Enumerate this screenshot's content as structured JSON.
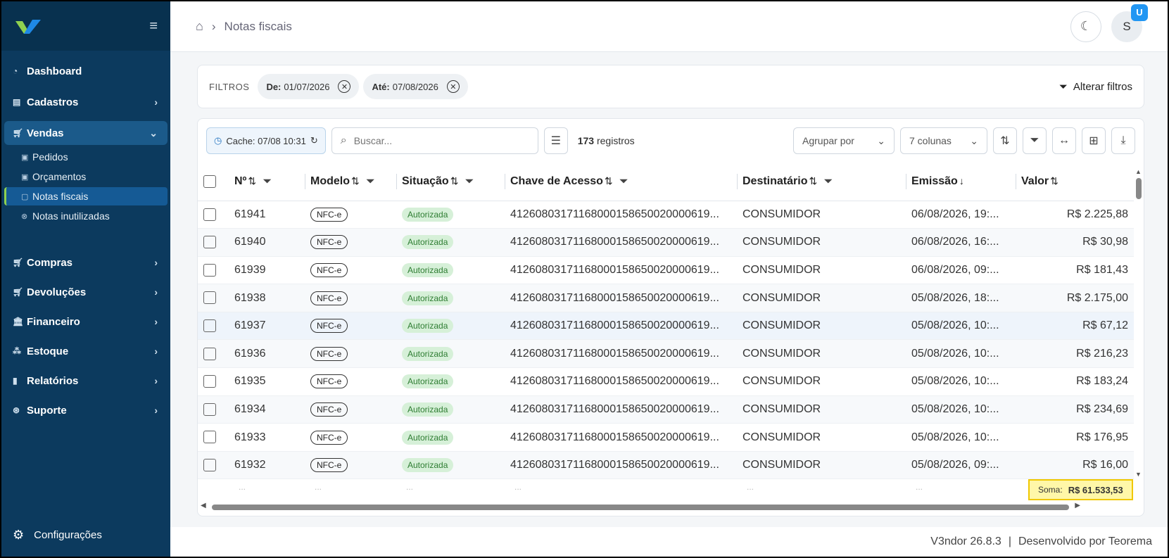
{
  "sidebar": {
    "items": [
      {
        "label": "Dashboard",
        "icon": "dashboard-icon"
      },
      {
        "label": "Cadastros",
        "icon": "list-icon"
      },
      {
        "label": "Vendas",
        "icon": "cart-icon"
      },
      {
        "label": "Compras",
        "icon": "cart-icon"
      },
      {
        "label": "Devoluções",
        "icon": "cart-icon"
      },
      {
        "label": "Financeiro",
        "icon": "bank-icon"
      },
      {
        "label": "Estoque",
        "icon": "boxes-icon"
      },
      {
        "label": "Relatórios",
        "icon": "bar-chart-icon"
      },
      {
        "label": "Suporte",
        "icon": "support-icon"
      }
    ],
    "sub_items": [
      {
        "label": "Pedidos"
      },
      {
        "label": "Orçamentos"
      },
      {
        "label": "Notas fiscais"
      },
      {
        "label": "Notas inutilizadas"
      }
    ],
    "settings_label": "Configurações"
  },
  "topbar": {
    "breadcrumb": "Notas fiscais",
    "avatar_letter": "S",
    "badge_letter": "U"
  },
  "filters": {
    "label": "FILTROS",
    "chips": [
      {
        "key": "De:",
        "value": "01/07/2026"
      },
      {
        "key": "Até:",
        "value": "07/08/2026"
      }
    ],
    "change_label": "Alterar filtros"
  },
  "toolbar": {
    "cache": "Cache: 07/08 10:31",
    "search_placeholder": "Buscar...",
    "count": "173",
    "count_suffix": "registros",
    "group_by": "Agrupar por",
    "columns": "7 colunas"
  },
  "table": {
    "headers": [
      "Nº",
      "Modelo",
      "Situação",
      "Chave de Acesso",
      "Destinatário",
      "Emissão",
      "Valor"
    ],
    "rows": [
      {
        "num": "61941",
        "modelo": "NFC-e",
        "situacao": "Autorizada",
        "chave": "41260803171168000158650020000619...",
        "dest": "CONSUMIDOR",
        "emissao": "06/08/2026, 19:...",
        "valor": "R$ 2.225,88"
      },
      {
        "num": "61940",
        "modelo": "NFC-e",
        "situacao": "Autorizada",
        "chave": "41260803171168000158650020000619...",
        "dest": "CONSUMIDOR",
        "emissao": "06/08/2026, 16:...",
        "valor": "R$ 30,98"
      },
      {
        "num": "61939",
        "modelo": "NFC-e",
        "situacao": "Autorizada",
        "chave": "41260803171168000158650020000619...",
        "dest": "CONSUMIDOR",
        "emissao": "06/08/2026, 09:...",
        "valor": "R$ 181,43"
      },
      {
        "num": "61938",
        "modelo": "NFC-e",
        "situacao": "Autorizada",
        "chave": "41260803171168000158650020000619...",
        "dest": "CONSUMIDOR",
        "emissao": "05/08/2026, 18:...",
        "valor": "R$ 2.175,00"
      },
      {
        "num": "61937",
        "modelo": "NFC-e",
        "situacao": "Autorizada",
        "chave": "41260803171168000158650020000619...",
        "dest": "CONSUMIDOR",
        "emissao": "05/08/2026, 10:...",
        "valor": "R$ 67,12"
      },
      {
        "num": "61936",
        "modelo": "NFC-e",
        "situacao": "Autorizada",
        "chave": "41260803171168000158650020000619...",
        "dest": "CONSUMIDOR",
        "emissao": "05/08/2026, 10:...",
        "valor": "R$ 216,23"
      },
      {
        "num": "61935",
        "modelo": "NFC-e",
        "situacao": "Autorizada",
        "chave": "41260803171168000158650020000619...",
        "dest": "CONSUMIDOR",
        "emissao": "05/08/2026, 10:...",
        "valor": "R$ 183,24"
      },
      {
        "num": "61934",
        "modelo": "NFC-e",
        "situacao": "Autorizada",
        "chave": "41260803171168000158650020000619...",
        "dest": "CONSUMIDOR",
        "emissao": "05/08/2026, 10:...",
        "valor": "R$ 234,69"
      },
      {
        "num": "61933",
        "modelo": "NFC-e",
        "situacao": "Autorizada",
        "chave": "41260803171168000158650020000619...",
        "dest": "CONSUMIDOR",
        "emissao": "05/08/2026, 10:...",
        "valor": "R$ 176,95"
      },
      {
        "num": "61932",
        "modelo": "NFC-e",
        "situacao": "Autorizada",
        "chave": "41260803171168000158650020000619...",
        "dest": "CONSUMIDOR",
        "emissao": "05/08/2026, 09:...",
        "valor": "R$ 16,00"
      }
    ],
    "placeholder_dots": "...",
    "soma_label": "Soma:",
    "soma_value": "R$ 61.533,53"
  },
  "footer": {
    "version": "V3ndor  26.8.3",
    "separator": "|",
    "credit": "Desenvolvido por Teorema"
  },
  "colors": {
    "sidebar": "#0c3a5e",
    "accent_green": "#8fd14f",
    "status_green": "#2e7d32",
    "soma_highlight": "#fff7a8"
  }
}
